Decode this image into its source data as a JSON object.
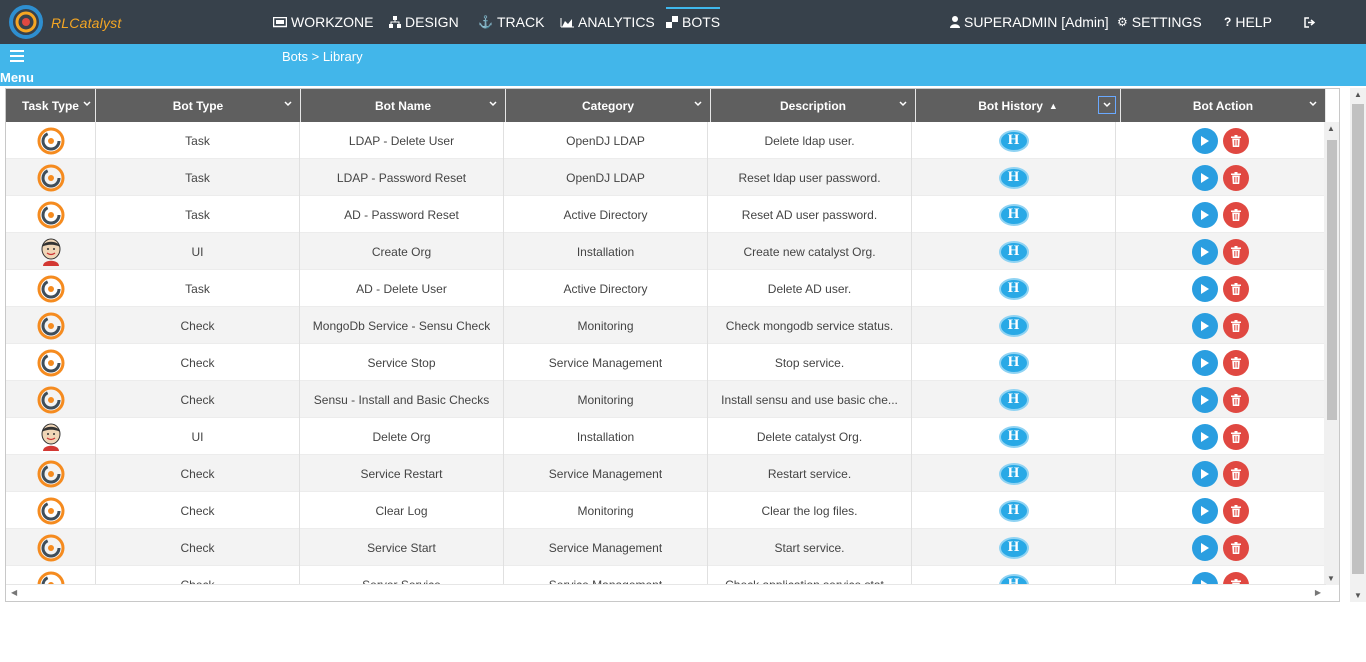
{
  "app": {
    "brand": "RLCatalyst"
  },
  "nav": {
    "workzone": "WORKZONE",
    "design": "DESIGN",
    "track": "TRACK",
    "analytics": "ANALYTICS",
    "bots": "BOTS",
    "user": "SUPERADMIN [Admin]",
    "settings": "SETTINGS",
    "help": "HELP",
    "active": "BOTS"
  },
  "subbar": {
    "menu_label": "Menu",
    "breadcrumb": "Bots > Library"
  },
  "grid": {
    "columns": [
      "Task Type",
      "Bot Type",
      "Bot Name",
      "Category",
      "Description",
      "Bot History",
      "Bot Action"
    ],
    "sorted_column": "Bot History",
    "history_button_label": "H",
    "rows": [
      {
        "task_type_icon": "chef-icon",
        "bot_type": "Task",
        "bot_name": "LDAP - Delete User",
        "category": "OpenDJ LDAP",
        "description": "Delete ldap user."
      },
      {
        "task_type_icon": "chef-icon",
        "bot_type": "Task",
        "bot_name": "LDAP - Password Reset",
        "category": "OpenDJ LDAP",
        "description": "Reset ldap user password."
      },
      {
        "task_type_icon": "chef-icon",
        "bot_type": "Task",
        "bot_name": "AD - Password Reset",
        "category": "Active Directory",
        "description": "Reset AD user password."
      },
      {
        "task_type_icon": "jenkins-icon",
        "bot_type": "UI",
        "bot_name": "Create Org",
        "category": "Installation",
        "description": "Create new catalyst Org."
      },
      {
        "task_type_icon": "chef-icon",
        "bot_type": "Task",
        "bot_name": "AD - Delete User",
        "category": "Active Directory",
        "description": "Delete AD user."
      },
      {
        "task_type_icon": "chef-icon",
        "bot_type": "Check",
        "bot_name": "MongoDb Service - Sensu Check",
        "category": "Monitoring",
        "description": "Check mongodb service status."
      },
      {
        "task_type_icon": "chef-icon",
        "bot_type": "Check",
        "bot_name": "Service Stop",
        "category": "Service Management",
        "description": "Stop service."
      },
      {
        "task_type_icon": "chef-icon",
        "bot_type": "Check",
        "bot_name": "Sensu - Install and Basic Checks",
        "category": "Monitoring",
        "description": "Install sensu and use basic che..."
      },
      {
        "task_type_icon": "jenkins-icon",
        "bot_type": "UI",
        "bot_name": "Delete Org",
        "category": "Installation",
        "description": "Delete catalyst Org."
      },
      {
        "task_type_icon": "chef-icon",
        "bot_type": "Check",
        "bot_name": "Service Restart",
        "category": "Service Management",
        "description": "Restart service."
      },
      {
        "task_type_icon": "chef-icon",
        "bot_type": "Check",
        "bot_name": "Clear Log",
        "category": "Monitoring",
        "description": "Clear the log files."
      },
      {
        "task_type_icon": "chef-icon",
        "bot_type": "Check",
        "bot_name": "Service Start",
        "category": "Service Management",
        "description": "Start service."
      },
      {
        "task_type_icon": "chef-icon",
        "bot_type": "Check",
        "bot_name": "Server Service",
        "category": "Service Management",
        "description": "Check application service stat..."
      }
    ]
  },
  "colors": {
    "topnav": "#37414b",
    "subbar": "#42b6ea",
    "grid_header": "#5f5f5f",
    "run": "#2a9ee0",
    "delete": "#e04841",
    "history": "#29a9e6",
    "brand": "#f5a623"
  }
}
